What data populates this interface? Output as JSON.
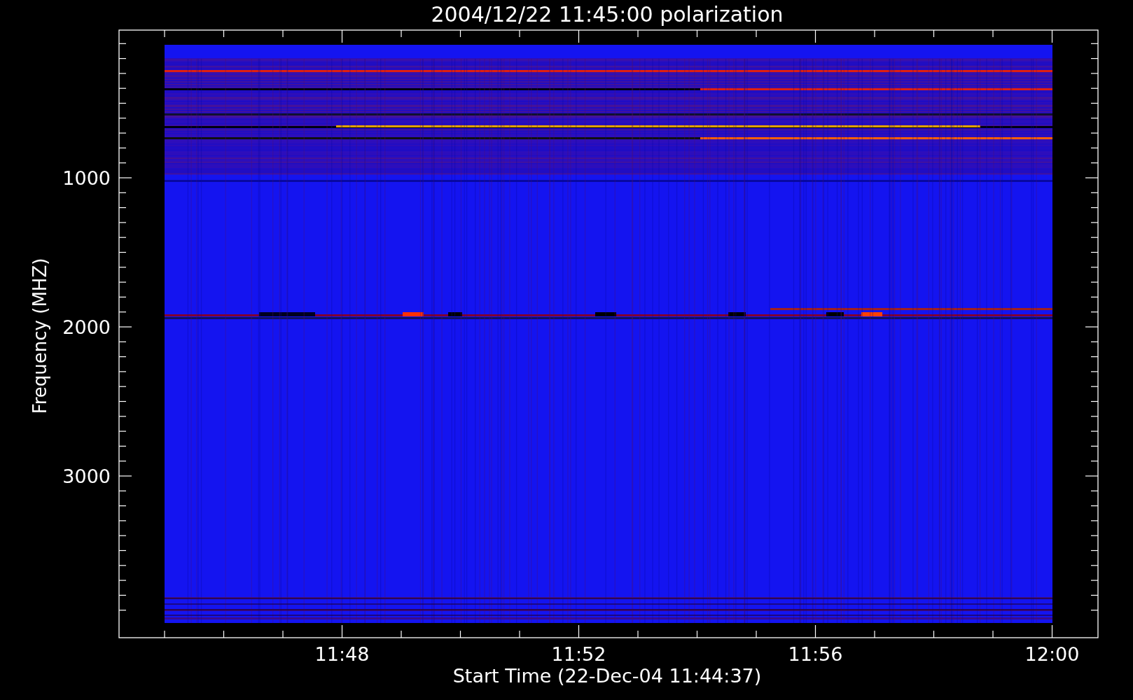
{
  "title": "2004/12/22 11:45:00 polarization",
  "ylabel": "Frequency (MHZ)",
  "xlabel": "Start Time (22-Dec-04 11:44:37)",
  "yticks": [
    "1000",
    "2000",
    "3000"
  ],
  "xticks": [
    "11:48",
    "11:52",
    "11:56",
    "12:00"
  ]
}
